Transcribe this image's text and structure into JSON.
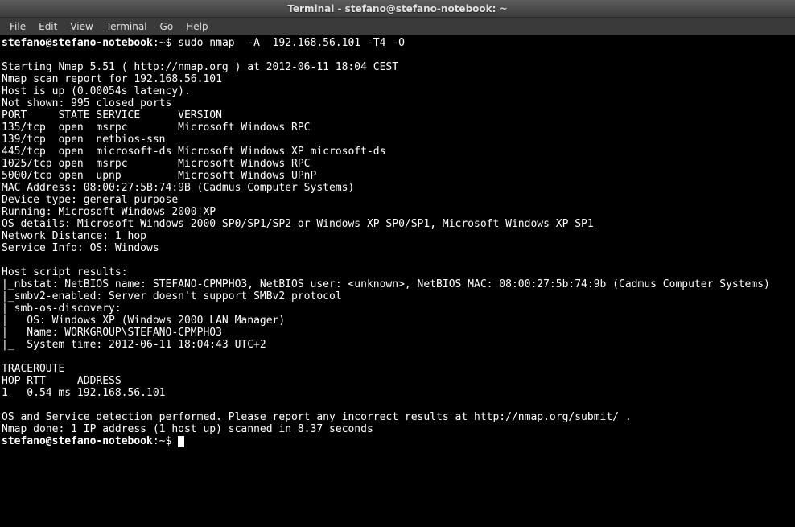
{
  "window": {
    "title": "Terminal - stefano@stefano-notebook: ~"
  },
  "menubar": {
    "file": "File",
    "edit": "Edit",
    "view": "View",
    "terminal": "Terminal",
    "go": "Go",
    "help": "Help"
  },
  "prompt": {
    "user_host": "stefano@stefano-notebook",
    "path": "~",
    "symbol": "$"
  },
  "command": "sudo nmap  -A  192.168.56.101 -T4 -O",
  "output": {
    "l01": "Starting Nmap 5.51 ( http://nmap.org ) at 2012-06-11 18:04 CEST",
    "l02": "Nmap scan report for 192.168.56.101",
    "l03": "Host is up (0.00054s latency).",
    "l04": "Not shown: 995 closed ports",
    "l05": "PORT     STATE SERVICE      VERSION",
    "l06": "135/tcp  open  msrpc        Microsoft Windows RPC",
    "l07": "139/tcp  open  netbios-ssn",
    "l08": "445/tcp  open  microsoft-ds Microsoft Windows XP microsoft-ds",
    "l09": "1025/tcp open  msrpc        Microsoft Windows RPC",
    "l10": "5000/tcp open  upnp         Microsoft Windows UPnP",
    "l11": "MAC Address: 08:00:27:5B:74:9B (Cadmus Computer Systems)",
    "l12": "Device type: general purpose",
    "l13": "Running: Microsoft Windows 2000|XP",
    "l14": "OS details: Microsoft Windows 2000 SP0/SP1/SP2 or Windows XP SP0/SP1, Microsoft Windows XP SP1",
    "l15": "Network Distance: 1 hop",
    "l16": "Service Info: OS: Windows",
    "l17": "Host script results:",
    "l18": "|_nbstat: NetBIOS name: STEFANO-CPMPHO3, NetBIOS user: <unknown>, NetBIOS MAC: 08:00:27:5b:74:9b (Cadmus Computer Systems)",
    "l19": "|_smbv2-enabled: Server doesn't support SMBv2 protocol",
    "l20": "| smb-os-discovery:",
    "l21": "|   OS: Windows XP (Windows 2000 LAN Manager)",
    "l22": "|   Name: WORKGROUP\\STEFANO-CPMPHO3",
    "l23": "|_  System time: 2012-06-11 18:04:43 UTC+2",
    "l24": "TRACEROUTE",
    "l25": "HOP RTT     ADDRESS",
    "l26": "1   0.54 ms 192.168.56.101",
    "l27": "OS and Service detection performed. Please report any incorrect results at http://nmap.org/submit/ .",
    "l28": "Nmap done: 1 IP address (1 host up) scanned in 8.37 seconds"
  }
}
